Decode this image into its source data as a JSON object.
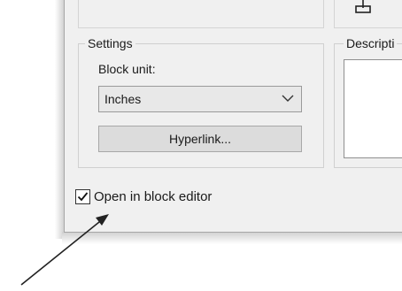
{
  "settings": {
    "group_title": "Settings",
    "block_unit_label": "Block unit:",
    "block_unit_value": "Inches",
    "hyperlink_button": "Hyperlink..."
  },
  "description": {
    "group_title": "Descripti"
  },
  "open_in_block_editor": {
    "label": "Open in block editor",
    "checked": true
  },
  "icons": {
    "dropdown": "chevron-down-icon",
    "checkbox": "checkmark-icon",
    "top": "block-insert-icon",
    "pointer": "arrow-pointer-icon"
  }
}
